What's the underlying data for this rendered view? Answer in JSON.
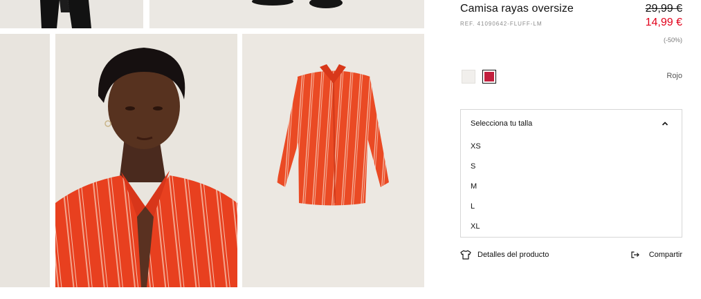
{
  "product": {
    "title": "Camisa rayas oversize",
    "reference": "REF. 41090642-FLUFF-LM",
    "price_old": "29,99 €",
    "price_new": "14,99 €",
    "discount": "(-50%)"
  },
  "colors": {
    "options": [
      {
        "name": "white-swatch",
        "hex": "#f1efec"
      },
      {
        "name": "red-swatch",
        "hex": "#c2203e"
      }
    ],
    "selected_label": "Rojo"
  },
  "sizes": {
    "header": "Selecciona tu talla",
    "options": [
      "XS",
      "S",
      "M",
      "L",
      "XL"
    ]
  },
  "actions": {
    "details_label": "Detalles del producto",
    "share_label": "Compartir"
  },
  "icons": {
    "details": "shirt-icon",
    "share": "share-exit-icon",
    "size_toggle": "chevron-up-icon"
  },
  "accent": {
    "sale_red": "#e2001a"
  }
}
